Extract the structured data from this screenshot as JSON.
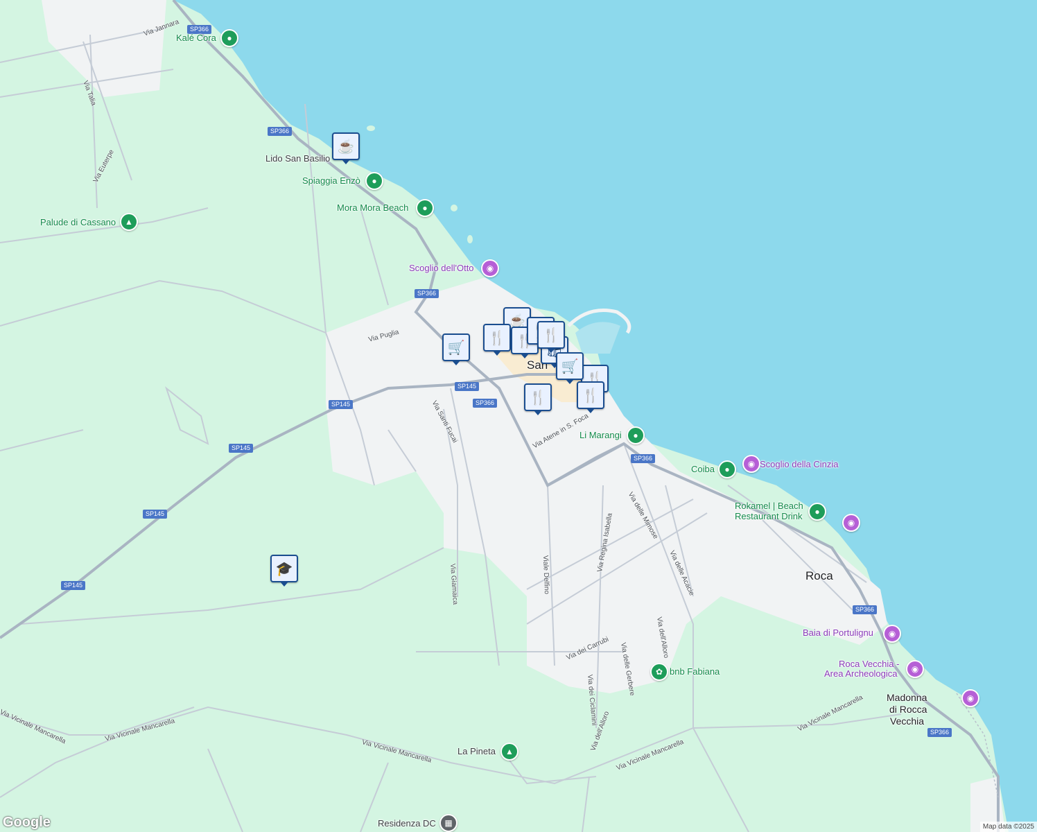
{
  "colors": {
    "sea": "#8dd9ec",
    "land": "#d4f5e2",
    "urban": "#f1f3f4",
    "road": "#c5ccd6",
    "major_road": "#a9b4c2",
    "water_dark": "#aee3ef",
    "shield": "#4a76c7"
  },
  "places": [
    {
      "name": "Kalé Cora",
      "type": "green"
    },
    {
      "name": "Lido San Basilio",
      "type": "plain"
    },
    {
      "name": "Spiaggia Enzò",
      "type": "green"
    },
    {
      "name": "Mora Mora Beach",
      "type": "green"
    },
    {
      "name": "Palude di Cassano",
      "type": "green"
    },
    {
      "name": "Scoglio dell'Otto",
      "type": "purple"
    },
    {
      "name": "Li Marangi",
      "type": "green"
    },
    {
      "name": "Coiba",
      "type": "green"
    },
    {
      "name": "Scoglio della Cinzia",
      "type": "purple"
    },
    {
      "name": "Rokamel | Beach",
      "type": "green"
    },
    {
      "name": "Restaurant Drink",
      "type": "green"
    },
    {
      "name": "Roca",
      "type": "town"
    },
    {
      "name": "Baia di Portulignu",
      "type": "purple"
    },
    {
      "name": "Roca Vecchia -",
      "type": "purple"
    },
    {
      "name": "Area Archeologica",
      "type": "purple"
    },
    {
      "name": "Madonna",
      "type": "town"
    },
    {
      "name": "di Rocca",
      "type": "town"
    },
    {
      "name": "Vecchia",
      "type": "town"
    },
    {
      "name": "bnb Fabiana",
      "type": "green"
    },
    {
      "name": "La Pineta",
      "type": "plain"
    },
    {
      "name": "Residenza DC",
      "type": "plain"
    },
    {
      "name": "San",
      "type": "town"
    }
  ],
  "roads": [
    "Via Jannara",
    "Via Talia",
    "Via Euterpe",
    "Via Puglia",
    "Via Santi Fucai",
    "Via Atene in S. Foca",
    "Via Giamaica",
    "Viale Delfino",
    "Via Regina Isabella",
    "Via delle Mimose",
    "Via delle Acacie",
    "Via dell'Alloro",
    "Via delle Gerbere",
    "Via dei Ciclamini",
    "Via dei Carrubi",
    "Via Vicinale Mancarella",
    "Via Vicinale Mancarella",
    "Via Vicinale Mancarella",
    "Via Vicinale Mancarella",
    "Via Vicinale Mancarella",
    "Via dell'Alloro"
  ],
  "shields": [
    "SP366",
    "SP366",
    "SP366",
    "SP145",
    "SP366",
    "SP145",
    "SP145",
    "SP145",
    "SP145",
    "SP366",
    "SP366",
    "SP366"
  ],
  "pins": [
    {
      "icon": "coffee-icon"
    },
    {
      "icon": "restaurant-icon"
    },
    {
      "icon": "restaurant-icon"
    },
    {
      "icon": "restaurant-icon"
    },
    {
      "icon": "shopping-cart-icon"
    },
    {
      "icon": "shopping-bag-icon"
    },
    {
      "icon": "restaurant-icon"
    },
    {
      "icon": "restaurant-icon"
    },
    {
      "icon": "restaurant-icon"
    },
    {
      "icon": "restaurant-icon"
    },
    {
      "icon": "school-icon"
    },
    {
      "icon": "coffee-icon"
    },
    {
      "icon": "shopping-cart-icon"
    }
  ],
  "footer": {
    "logo": "Google",
    "attribution": "Map data ©2025"
  }
}
